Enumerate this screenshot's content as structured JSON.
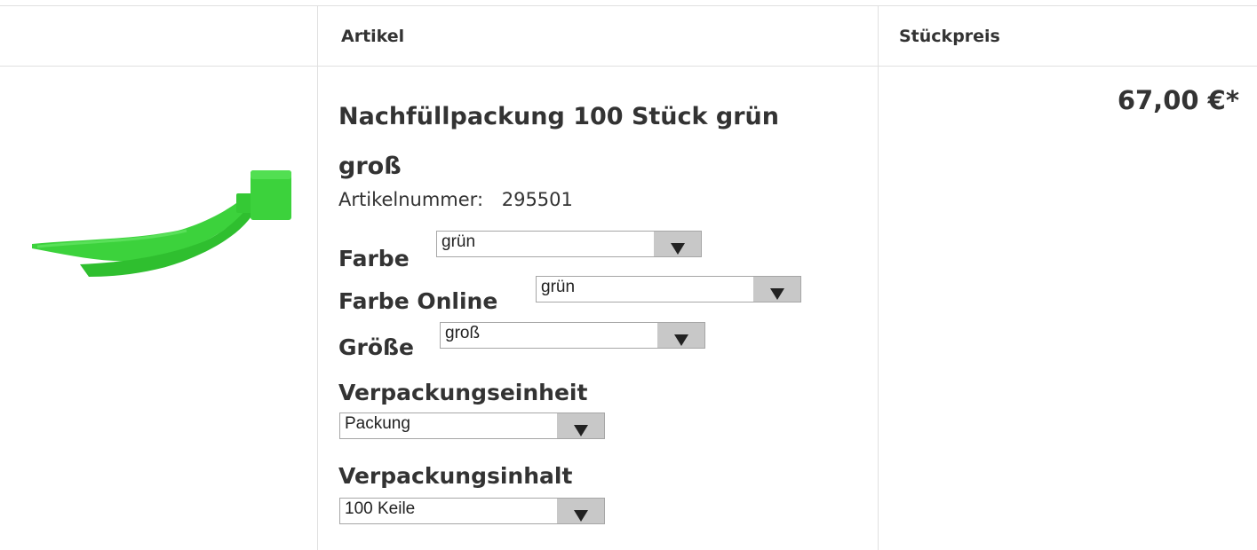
{
  "header": {
    "col_article": "Artikel",
    "col_unit_price": "Stückpreis"
  },
  "product": {
    "image_icon": "green-wedge-image",
    "title": "Nachfüllpackung 100 Stück grün groß",
    "article_number_label": "Artikelnummer:",
    "article_number": "295501",
    "price": "67,00 €*",
    "accent_color": "#3cd23c",
    "options": [
      {
        "label": "Farbe",
        "value": "grün"
      },
      {
        "label": "Farbe Online",
        "value": "grün"
      },
      {
        "label": "Größe",
        "value": "groß"
      },
      {
        "label": "Verpackungseinheit",
        "value": "Packung"
      },
      {
        "label": "Verpackungsinhalt",
        "value": "100 Keile"
      }
    ]
  }
}
